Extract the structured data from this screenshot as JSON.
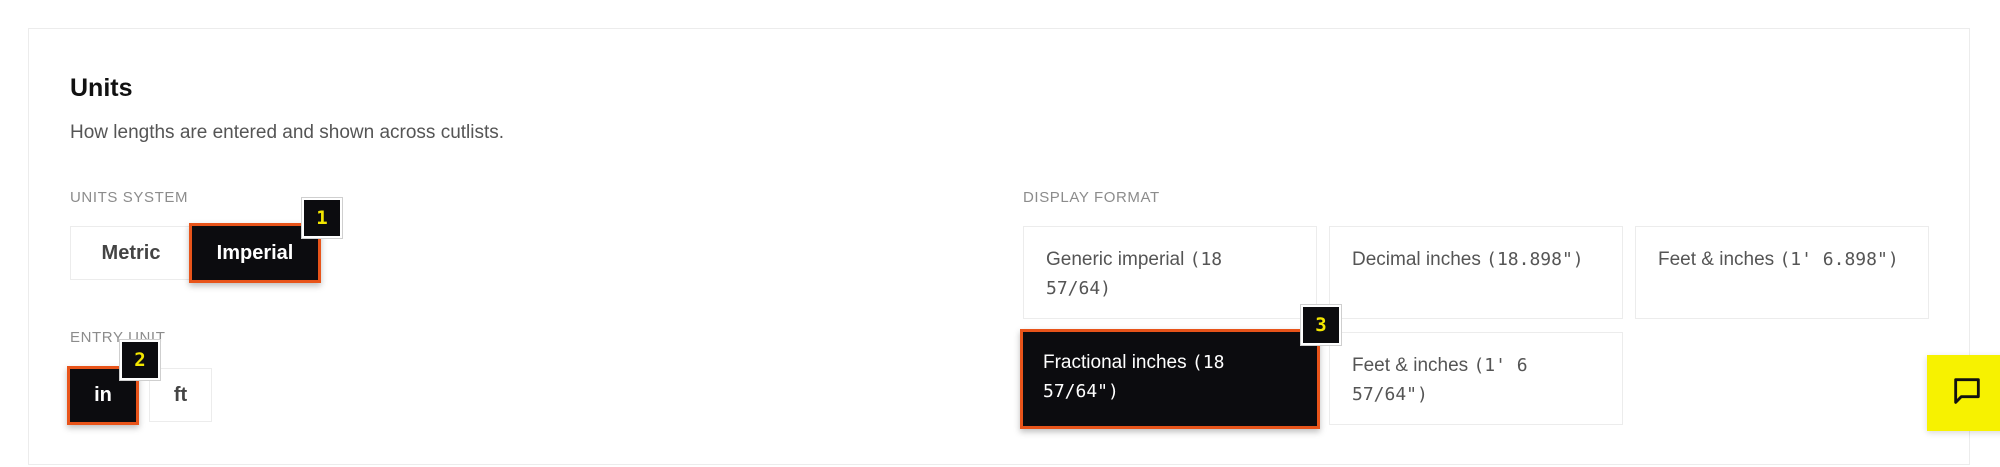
{
  "header": {
    "title": "Units",
    "subtitle": "How lengths are entered and shown across cutlists."
  },
  "units_system": {
    "label": "UNITS SYSTEM",
    "options": [
      {
        "label": "Metric",
        "selected": false
      },
      {
        "label": "Imperial",
        "selected": true
      }
    ],
    "badge": "1"
  },
  "entry_unit": {
    "label": "ENTRY UNIT",
    "options": [
      {
        "label": "in",
        "selected": true
      },
      {
        "label": "ft",
        "selected": false
      }
    ],
    "badge": "2"
  },
  "display_format": {
    "label": "DISPLAY FORMAT",
    "options": [
      {
        "name": "Generic imperial",
        "example": "(18 57/64)",
        "selected": false
      },
      {
        "name": "Decimal inches",
        "example": "(18.898\")",
        "selected": false
      },
      {
        "name": "Feet & inches",
        "example": "(1' 6.898\")",
        "selected": false
      },
      {
        "name": "Fractional inches",
        "example": "(18 57/64\")",
        "selected": true
      },
      {
        "name": "Feet & inches",
        "example": "(1' 6 57/64\")",
        "selected": false
      }
    ],
    "badge": "3"
  },
  "chat": {
    "icon": "chat-bubble-icon"
  },
  "colors": {
    "accent_border": "#e8541a",
    "selected_bg": "#0c0c0f",
    "badge_text": "#f3e600",
    "chat_bg": "#f7f200"
  }
}
